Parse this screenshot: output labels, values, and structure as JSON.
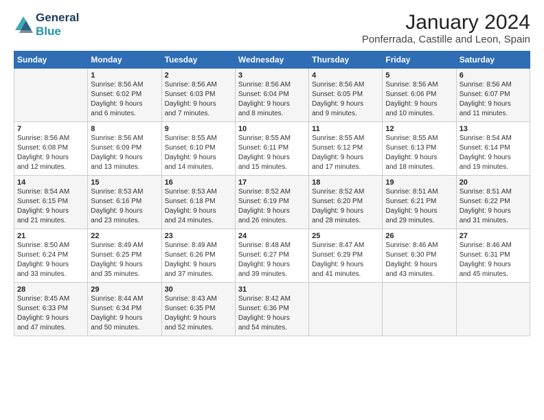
{
  "header": {
    "logo_line1": "General",
    "logo_line2": "Blue",
    "title": "January 2024",
    "subtitle": "Ponferrada, Castille and Leon, Spain"
  },
  "weekdays": [
    "Sunday",
    "Monday",
    "Tuesday",
    "Wednesday",
    "Thursday",
    "Friday",
    "Saturday"
  ],
  "rows": [
    [
      {
        "day": "",
        "content": ""
      },
      {
        "day": "1",
        "content": "Sunrise: 8:56 AM\nSunset: 6:02 PM\nDaylight: 9 hours\nand 6 minutes."
      },
      {
        "day": "2",
        "content": "Sunrise: 8:56 AM\nSunset: 6:03 PM\nDaylight: 9 hours\nand 7 minutes."
      },
      {
        "day": "3",
        "content": "Sunrise: 8:56 AM\nSunset: 6:04 PM\nDaylight: 9 hours\nand 8 minutes."
      },
      {
        "day": "4",
        "content": "Sunrise: 8:56 AM\nSunset: 6:05 PM\nDaylight: 9 hours\nand 9 minutes."
      },
      {
        "day": "5",
        "content": "Sunrise: 8:56 AM\nSunset: 6:06 PM\nDaylight: 9 hours\nand 10 minutes."
      },
      {
        "day": "6",
        "content": "Sunrise: 8:56 AM\nSunset: 6:07 PM\nDaylight: 9 hours\nand 11 minutes."
      }
    ],
    [
      {
        "day": "7",
        "content": "Sunrise: 8:56 AM\nSunset: 6:08 PM\nDaylight: 9 hours\nand 12 minutes."
      },
      {
        "day": "8",
        "content": "Sunrise: 8:56 AM\nSunset: 6:09 PM\nDaylight: 9 hours\nand 13 minutes."
      },
      {
        "day": "9",
        "content": "Sunrise: 8:55 AM\nSunset: 6:10 PM\nDaylight: 9 hours\nand 14 minutes."
      },
      {
        "day": "10",
        "content": "Sunrise: 8:55 AM\nSunset: 6:11 PM\nDaylight: 9 hours\nand 15 minutes."
      },
      {
        "day": "11",
        "content": "Sunrise: 8:55 AM\nSunset: 6:12 PM\nDaylight: 9 hours\nand 17 minutes."
      },
      {
        "day": "12",
        "content": "Sunrise: 8:55 AM\nSunset: 6:13 PM\nDaylight: 9 hours\nand 18 minutes."
      },
      {
        "day": "13",
        "content": "Sunrise: 8:54 AM\nSunset: 6:14 PM\nDaylight: 9 hours\nand 19 minutes."
      }
    ],
    [
      {
        "day": "14",
        "content": "Sunrise: 8:54 AM\nSunset: 6:15 PM\nDaylight: 9 hours\nand 21 minutes."
      },
      {
        "day": "15",
        "content": "Sunrise: 8:53 AM\nSunset: 6:16 PM\nDaylight: 9 hours\nand 23 minutes."
      },
      {
        "day": "16",
        "content": "Sunrise: 8:53 AM\nSunset: 6:18 PM\nDaylight: 9 hours\nand 24 minutes."
      },
      {
        "day": "17",
        "content": "Sunrise: 8:52 AM\nSunset: 6:19 PM\nDaylight: 9 hours\nand 26 minutes."
      },
      {
        "day": "18",
        "content": "Sunrise: 8:52 AM\nSunset: 6:20 PM\nDaylight: 9 hours\nand 28 minutes."
      },
      {
        "day": "19",
        "content": "Sunrise: 8:51 AM\nSunset: 6:21 PM\nDaylight: 9 hours\nand 29 minutes."
      },
      {
        "day": "20",
        "content": "Sunrise: 8:51 AM\nSunset: 6:22 PM\nDaylight: 9 hours\nand 31 minutes."
      }
    ],
    [
      {
        "day": "21",
        "content": "Sunrise: 8:50 AM\nSunset: 6:24 PM\nDaylight: 9 hours\nand 33 minutes."
      },
      {
        "day": "22",
        "content": "Sunrise: 8:49 AM\nSunset: 6:25 PM\nDaylight: 9 hours\nand 35 minutes."
      },
      {
        "day": "23",
        "content": "Sunrise: 8:49 AM\nSunset: 6:26 PM\nDaylight: 9 hours\nand 37 minutes."
      },
      {
        "day": "24",
        "content": "Sunrise: 8:48 AM\nSunset: 6:27 PM\nDaylight: 9 hours\nand 39 minutes."
      },
      {
        "day": "25",
        "content": "Sunrise: 8:47 AM\nSunset: 6:29 PM\nDaylight: 9 hours\nand 41 minutes."
      },
      {
        "day": "26",
        "content": "Sunrise: 8:46 AM\nSunset: 6:30 PM\nDaylight: 9 hours\nand 43 minutes."
      },
      {
        "day": "27",
        "content": "Sunrise: 8:46 AM\nSunset: 6:31 PM\nDaylight: 9 hours\nand 45 minutes."
      }
    ],
    [
      {
        "day": "28",
        "content": "Sunrise: 8:45 AM\nSunset: 6:33 PM\nDaylight: 9 hours\nand 47 minutes."
      },
      {
        "day": "29",
        "content": "Sunrise: 8:44 AM\nSunset: 6:34 PM\nDaylight: 9 hours\nand 50 minutes."
      },
      {
        "day": "30",
        "content": "Sunrise: 8:43 AM\nSunset: 6:35 PM\nDaylight: 9 hours\nand 52 minutes."
      },
      {
        "day": "31",
        "content": "Sunrise: 8:42 AM\nSunset: 6:36 PM\nDaylight: 9 hours\nand 54 minutes."
      },
      {
        "day": "",
        "content": ""
      },
      {
        "day": "",
        "content": ""
      },
      {
        "day": "",
        "content": ""
      }
    ]
  ]
}
